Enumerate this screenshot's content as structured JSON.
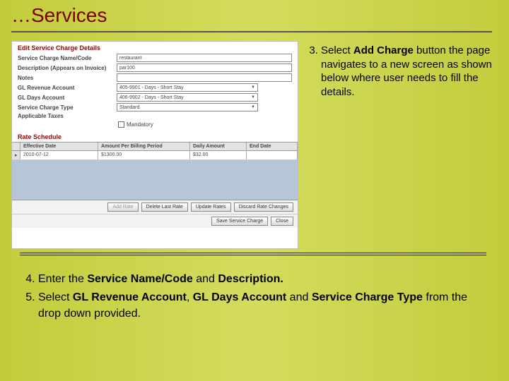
{
  "title": "…Services",
  "screenshot": {
    "header": "Edit Service Charge Details",
    "fields": {
      "name_label": "Service Charge Name/Code",
      "name_value": "restaurant",
      "desc_label": "Description (Appears on Invoice)",
      "desc_value": "par100",
      "notes_label": "Notes",
      "notes_value": "",
      "gl_rev_label": "GL Revenue Account",
      "gl_rev_value": "405-9901 - Days - Short Stay",
      "gl_days_label": "GL Days Account",
      "gl_days_value": "406-9902 - Days - Short Stay",
      "sctype_label": "Service Charge Type",
      "sctype_value": "Standard",
      "taxes_label": "Applicable Taxes",
      "mandatory_label": "Mandatory"
    },
    "rate_schedule_header": "Rate Schedule",
    "grid": {
      "cols": {
        "effective": "Effective Date",
        "amount": "Amount Per Billing Period",
        "daily": "Daily Amount",
        "end": "End Date"
      },
      "row": {
        "effective": "2010-07-12",
        "amount": "$1300.00",
        "daily": "$32.00",
        "end": ""
      }
    },
    "buttons1": {
      "add": "Add Rate",
      "delLast": "Delete Last Rate",
      "update": "Update Rates",
      "discard": "Discard Rate Changes"
    },
    "buttons2": {
      "save": "Save Service Charge",
      "close": "Close"
    }
  },
  "instr3": {
    "pre": "Select ",
    "bold": "Add Charge",
    "post": " button the page navigates to a new screen as shown below where user needs to fill the details."
  },
  "instr4": {
    "pre": "Enter the ",
    "b1": "Service Name/Code",
    "mid": " and ",
    "b2": "Description."
  },
  "instr5": {
    "pre": "Select ",
    "b1": "GL Revenue Account",
    "c1": ", ",
    "b2": "GL Days Account",
    "mid": " and ",
    "b3": "Service Charge Type",
    "post": " from the drop down provided."
  }
}
